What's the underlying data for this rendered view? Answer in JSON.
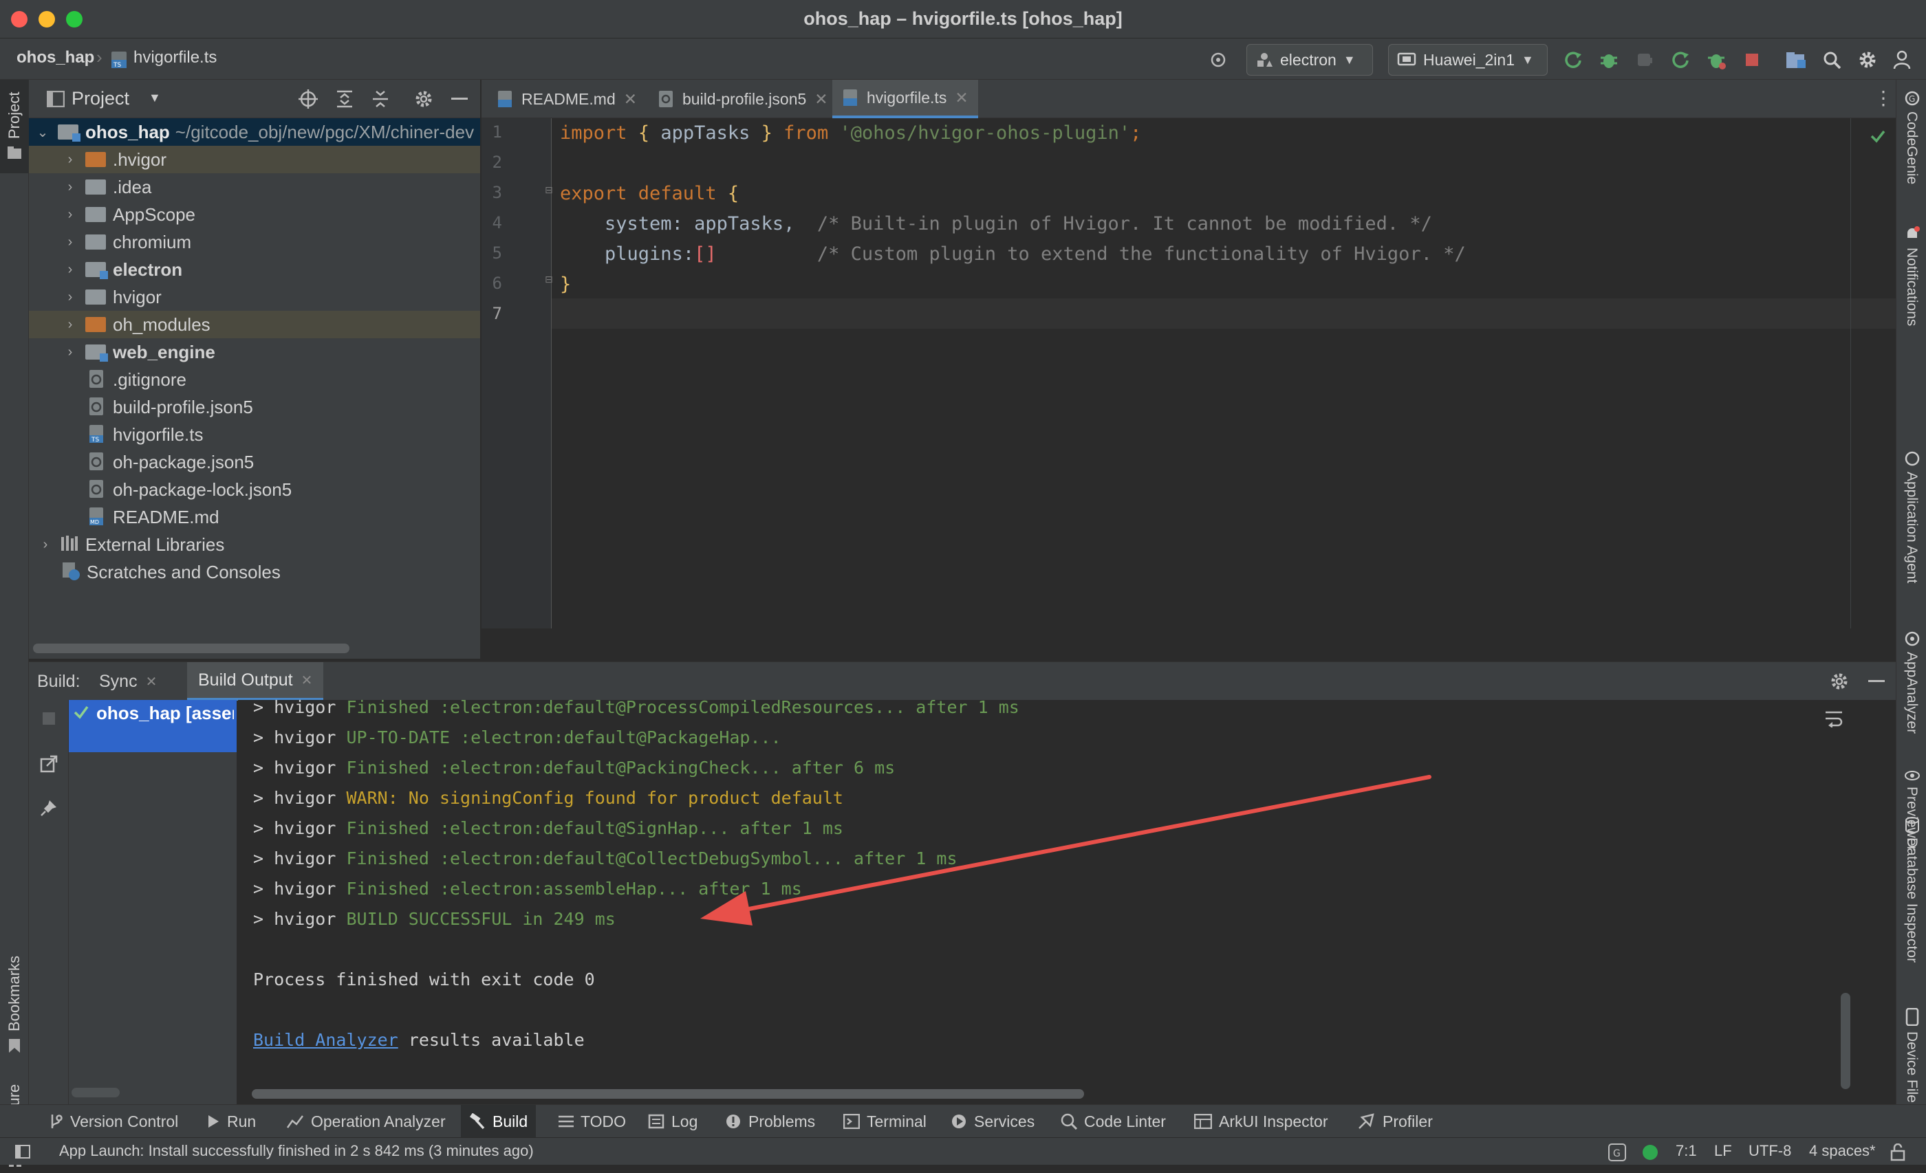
{
  "window": {
    "title": "ohos_hap – hvigorfile.ts [ohos_hap]"
  },
  "breadcrumb": {
    "project": "ohos_hap",
    "file": "hvigorfile.ts"
  },
  "toolbar": {
    "module": "electron",
    "device": "Huawei_2in1"
  },
  "project_panel": {
    "title": "Project",
    "root": {
      "name": "ohos_hap",
      "path": "~/gitcode_obj/new/pgc/XM/chiner-dev"
    },
    "items": [
      {
        "label": ".hvigor",
        "kind": "folder-excluded"
      },
      {
        "label": ".idea",
        "kind": "folder"
      },
      {
        "label": "AppScope",
        "kind": "folder"
      },
      {
        "label": "chromium",
        "kind": "folder"
      },
      {
        "label": "electron",
        "kind": "module"
      },
      {
        "label": "hvigor",
        "kind": "folder"
      },
      {
        "label": "oh_modules",
        "kind": "folder-excluded"
      },
      {
        "label": "web_engine",
        "kind": "module"
      },
      {
        "label": ".gitignore",
        "kind": "file"
      },
      {
        "label": "build-profile.json5",
        "kind": "file"
      },
      {
        "label": "hvigorfile.ts",
        "kind": "ts-file"
      },
      {
        "label": "oh-package.json5",
        "kind": "file"
      },
      {
        "label": "oh-package-lock.json5",
        "kind": "file"
      },
      {
        "label": "README.md",
        "kind": "md-file"
      }
    ],
    "external": "External Libraries",
    "scratches": "Scratches and Consoles"
  },
  "editor_tabs": [
    "README.md",
    "build-profile.json5",
    "hvigorfile.ts"
  ],
  "code": {
    "line_numbers": [
      "1",
      "2",
      "3",
      "4",
      "5",
      "6",
      "7"
    ],
    "l1_import": "import",
    "l1_brace_open": "{",
    "l1_name": " appTasks ",
    "l1_brace_close": "}",
    "l1_from": "from",
    "l1_str": "'@ohos/hvigor-ohos-plugin'",
    "l1_semi": ";",
    "l3_export": "export default",
    "l3_brace": "{",
    "l4_key": "system: appTasks,",
    "l4_comment": "/* Built-in plugin of Hvigor. It cannot be modified. */",
    "l5_key": "plugins:",
    "l5_arr": "[]",
    "l5_comment": "/* Custom plugin to extend the functionality of Hvigor. */",
    "l6_brace": "}"
  },
  "build_panel": {
    "label": "Build:",
    "tabs": [
      "Sync",
      "Build Output"
    ],
    "tree_item": "ohos_hap [assem",
    "prefix": "> hvigor",
    "lines": [
      {
        "text": "Finished :electron:default@ProcessCompiledResources... after 1 ms",
        "kind": "ok"
      },
      {
        "text": "UP-TO-DATE :electron:default@PackageHap...",
        "kind": "ok"
      },
      {
        "text": "Finished :electron:default@PackingCheck... after 6 ms",
        "kind": "ok"
      },
      {
        "text": "WARN: No signingConfig found for product default",
        "kind": "warn"
      },
      {
        "text": "Finished :electron:default@SignHap... after 1 ms",
        "kind": "ok"
      },
      {
        "text": "Finished :electron:default@CollectDebugSymbol... after 1 ms",
        "kind": "ok"
      },
      {
        "text": "Finished :electron:assembleHap... after 1 ms",
        "kind": "ok"
      },
      {
        "text": "BUILD SUCCESSFUL in 249 ms",
        "kind": "ok"
      }
    ],
    "process_line": "Process finished with exit code 0",
    "analyzer_link": "Build Analyzer",
    "analyzer_rest": " results available"
  },
  "left_strip": {
    "project": "Project",
    "bookmarks": "Bookmarks",
    "structure": "Structure"
  },
  "right_strip": [
    "CodeGenie",
    "Notifications",
    "Application Agent",
    "AppAnalyzer",
    "Previewer",
    "Database Inspector",
    "Device File"
  ],
  "tool_windows": [
    "Version Control",
    "Run",
    "Operation Analyzer",
    "Build",
    "TODO",
    "Log",
    "Problems",
    "Terminal",
    "Services",
    "Code Linter",
    "ArkUI Inspector",
    "Profiler"
  ],
  "status": {
    "message": "App Launch: Install successfully finished in 2 s 842 ms (3 minutes ago)",
    "position": "7:1",
    "line_sep": "LF",
    "encoding": "UTF-8",
    "indent": "4 spaces*"
  },
  "colors": {
    "accent": "#4a88c7",
    "success": "#6a9a54",
    "warn": "#c8a22d",
    "annotation_arrow": "#e8504a"
  }
}
